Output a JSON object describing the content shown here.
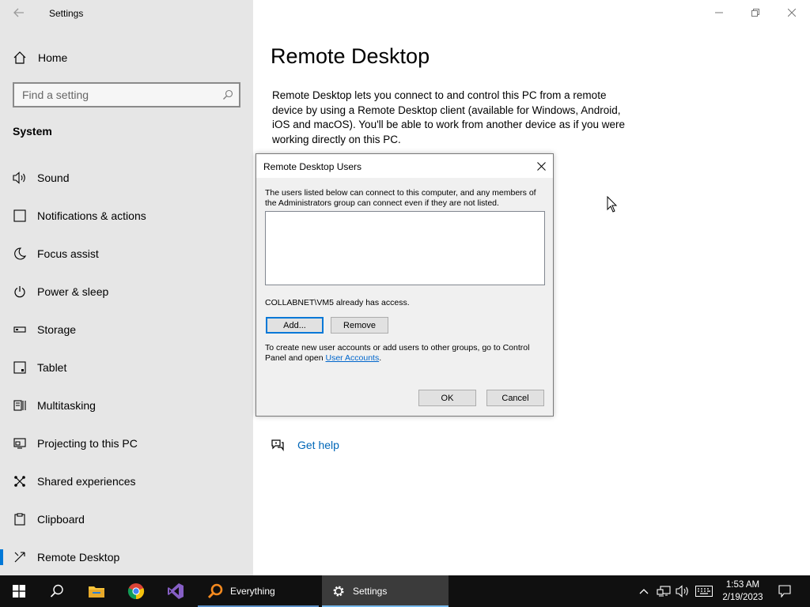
{
  "window": {
    "app_title": "Settings",
    "controls": [
      "minimize-icon",
      "restore-icon",
      "close-icon"
    ]
  },
  "sidebar": {
    "home_label": "Home",
    "search_placeholder": "Find a setting",
    "section_title": "System",
    "items": [
      {
        "label": "Sound",
        "icon": "speaker-icon"
      },
      {
        "label": "Notifications & actions",
        "icon": "notification-icon"
      },
      {
        "label": "Focus assist",
        "icon": "moon-icon"
      },
      {
        "label": "Power & sleep",
        "icon": "power-icon"
      },
      {
        "label": "Storage",
        "icon": "storage-icon"
      },
      {
        "label": "Tablet",
        "icon": "tablet-icon"
      },
      {
        "label": "Multitasking",
        "icon": "multitasking-icon"
      },
      {
        "label": "Projecting to this PC",
        "icon": "projecting-icon"
      },
      {
        "label": "Shared experiences",
        "icon": "shared-experiences-icon"
      },
      {
        "label": "Clipboard",
        "icon": "clipboard-icon"
      },
      {
        "label": "Remote Desktop",
        "icon": "remote-desktop-icon",
        "active": true
      }
    ]
  },
  "main": {
    "title": "Remote Desktop",
    "description": "Remote Desktop lets you connect to and control this PC from a remote device by using a Remote Desktop client (available for Windows, Android, iOS and macOS). You'll be able to work from another device as if you were working directly on this PC.",
    "get_help_label": "Get help"
  },
  "dialog": {
    "title": "Remote Desktop Users",
    "intro_text": "The users listed below can connect to this computer, and any members of the Administrators group can connect even if they are not listed.",
    "access_text": "COLLABNET\\VM5 already has access.",
    "add_label": "Add...",
    "remove_label": "Remove",
    "info_text": "To create new user accounts or add users to other groups, go to Control Panel and open",
    "info_link": "User Accounts",
    "info_end": ".",
    "ok_label": "OK",
    "cancel_label": "Cancel"
  },
  "taskbar": {
    "apps": [
      {
        "name": "start",
        "icon": "windows-logo-icon"
      },
      {
        "name": "search",
        "icon": "search-icon"
      },
      {
        "name": "file-explorer",
        "icon": "folder-icon"
      },
      {
        "name": "chrome",
        "icon": "chrome-icon"
      },
      {
        "name": "visual-studio",
        "icon": "visual-studio-icon"
      },
      {
        "name": "everything",
        "icon": "everything-icon",
        "label": "Everything"
      },
      {
        "name": "settings",
        "icon": "gear-icon",
        "label": "Settings",
        "active": true
      }
    ],
    "time": "1:53 AM",
    "date": "2/19/2023"
  },
  "colors": {
    "accent": "#0078d7",
    "link": "#0067b8",
    "sidebar_bg": "#e6e6e6",
    "taskbar_bg": "#101010"
  }
}
